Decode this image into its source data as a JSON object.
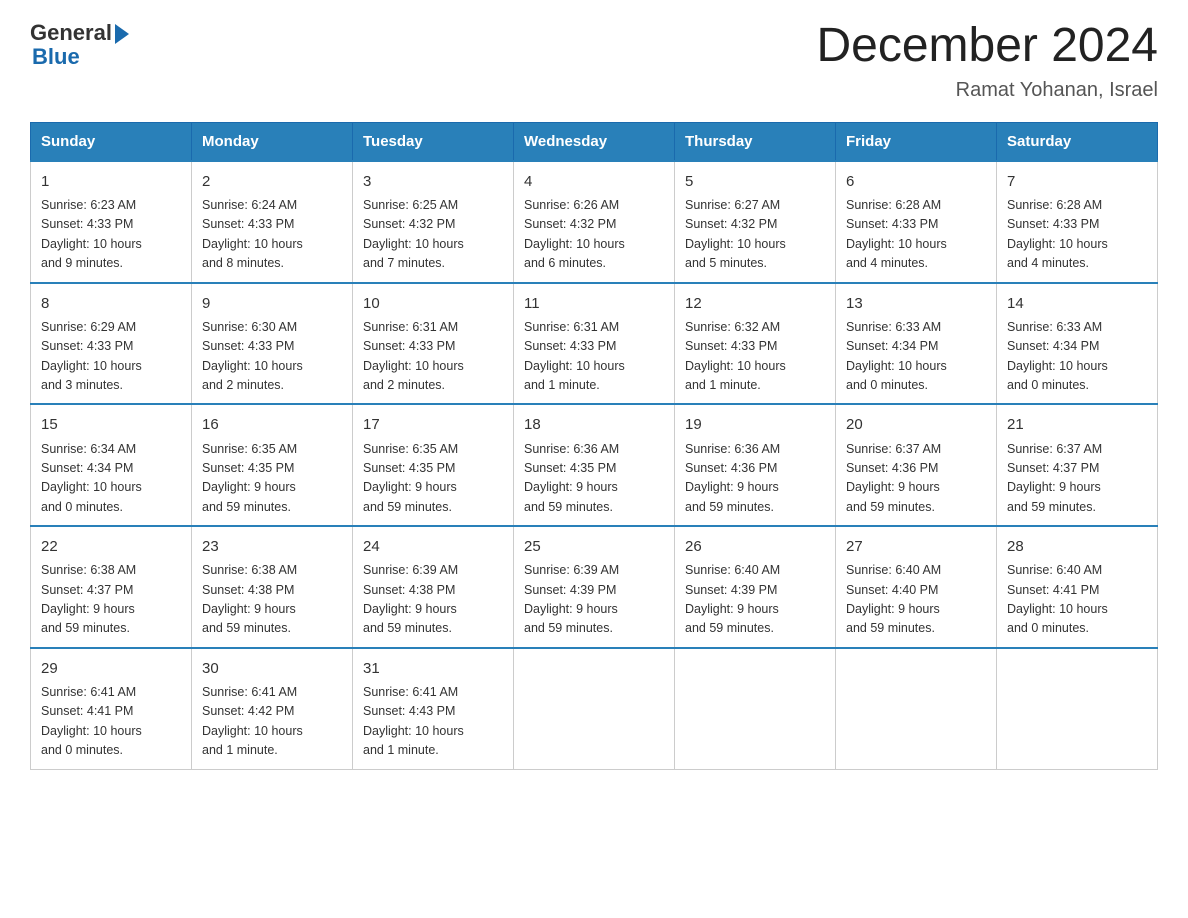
{
  "logo": {
    "general": "General",
    "blue": "Blue"
  },
  "title": "December 2024",
  "subtitle": "Ramat Yohanan, Israel",
  "weekdays": [
    "Sunday",
    "Monday",
    "Tuesday",
    "Wednesday",
    "Thursday",
    "Friday",
    "Saturday"
  ],
  "weeks": [
    [
      {
        "day": "1",
        "sunrise": "6:23 AM",
        "sunset": "4:33 PM",
        "daylight": "10 hours and 9 minutes."
      },
      {
        "day": "2",
        "sunrise": "6:24 AM",
        "sunset": "4:33 PM",
        "daylight": "10 hours and 8 minutes."
      },
      {
        "day": "3",
        "sunrise": "6:25 AM",
        "sunset": "4:32 PM",
        "daylight": "10 hours and 7 minutes."
      },
      {
        "day": "4",
        "sunrise": "6:26 AM",
        "sunset": "4:32 PM",
        "daylight": "10 hours and 6 minutes."
      },
      {
        "day": "5",
        "sunrise": "6:27 AM",
        "sunset": "4:32 PM",
        "daylight": "10 hours and 5 minutes."
      },
      {
        "day": "6",
        "sunrise": "6:28 AM",
        "sunset": "4:33 PM",
        "daylight": "10 hours and 4 minutes."
      },
      {
        "day": "7",
        "sunrise": "6:28 AM",
        "sunset": "4:33 PM",
        "daylight": "10 hours and 4 minutes."
      }
    ],
    [
      {
        "day": "8",
        "sunrise": "6:29 AM",
        "sunset": "4:33 PM",
        "daylight": "10 hours and 3 minutes."
      },
      {
        "day": "9",
        "sunrise": "6:30 AM",
        "sunset": "4:33 PM",
        "daylight": "10 hours and 2 minutes."
      },
      {
        "day": "10",
        "sunrise": "6:31 AM",
        "sunset": "4:33 PM",
        "daylight": "10 hours and 2 minutes."
      },
      {
        "day": "11",
        "sunrise": "6:31 AM",
        "sunset": "4:33 PM",
        "daylight": "10 hours and 1 minute."
      },
      {
        "day": "12",
        "sunrise": "6:32 AM",
        "sunset": "4:33 PM",
        "daylight": "10 hours and 1 minute."
      },
      {
        "day": "13",
        "sunrise": "6:33 AM",
        "sunset": "4:34 PM",
        "daylight": "10 hours and 0 minutes."
      },
      {
        "day": "14",
        "sunrise": "6:33 AM",
        "sunset": "4:34 PM",
        "daylight": "10 hours and 0 minutes."
      }
    ],
    [
      {
        "day": "15",
        "sunrise": "6:34 AM",
        "sunset": "4:34 PM",
        "daylight": "10 hours and 0 minutes."
      },
      {
        "day": "16",
        "sunrise": "6:35 AM",
        "sunset": "4:35 PM",
        "daylight": "9 hours and 59 minutes."
      },
      {
        "day": "17",
        "sunrise": "6:35 AM",
        "sunset": "4:35 PM",
        "daylight": "9 hours and 59 minutes."
      },
      {
        "day": "18",
        "sunrise": "6:36 AM",
        "sunset": "4:35 PM",
        "daylight": "9 hours and 59 minutes."
      },
      {
        "day": "19",
        "sunrise": "6:36 AM",
        "sunset": "4:36 PM",
        "daylight": "9 hours and 59 minutes."
      },
      {
        "day": "20",
        "sunrise": "6:37 AM",
        "sunset": "4:36 PM",
        "daylight": "9 hours and 59 minutes."
      },
      {
        "day": "21",
        "sunrise": "6:37 AM",
        "sunset": "4:37 PM",
        "daylight": "9 hours and 59 minutes."
      }
    ],
    [
      {
        "day": "22",
        "sunrise": "6:38 AM",
        "sunset": "4:37 PM",
        "daylight": "9 hours and 59 minutes."
      },
      {
        "day": "23",
        "sunrise": "6:38 AM",
        "sunset": "4:38 PM",
        "daylight": "9 hours and 59 minutes."
      },
      {
        "day": "24",
        "sunrise": "6:39 AM",
        "sunset": "4:38 PM",
        "daylight": "9 hours and 59 minutes."
      },
      {
        "day": "25",
        "sunrise": "6:39 AM",
        "sunset": "4:39 PM",
        "daylight": "9 hours and 59 minutes."
      },
      {
        "day": "26",
        "sunrise": "6:40 AM",
        "sunset": "4:39 PM",
        "daylight": "9 hours and 59 minutes."
      },
      {
        "day": "27",
        "sunrise": "6:40 AM",
        "sunset": "4:40 PM",
        "daylight": "9 hours and 59 minutes."
      },
      {
        "day": "28",
        "sunrise": "6:40 AM",
        "sunset": "4:41 PM",
        "daylight": "10 hours and 0 minutes."
      }
    ],
    [
      {
        "day": "29",
        "sunrise": "6:41 AM",
        "sunset": "4:41 PM",
        "daylight": "10 hours and 0 minutes."
      },
      {
        "day": "30",
        "sunrise": "6:41 AM",
        "sunset": "4:42 PM",
        "daylight": "10 hours and 1 minute."
      },
      {
        "day": "31",
        "sunrise": "6:41 AM",
        "sunset": "4:43 PM",
        "daylight": "10 hours and 1 minute."
      },
      null,
      null,
      null,
      null
    ]
  ],
  "labels": {
    "sunrise": "Sunrise:",
    "sunset": "Sunset:",
    "daylight": "Daylight:"
  }
}
